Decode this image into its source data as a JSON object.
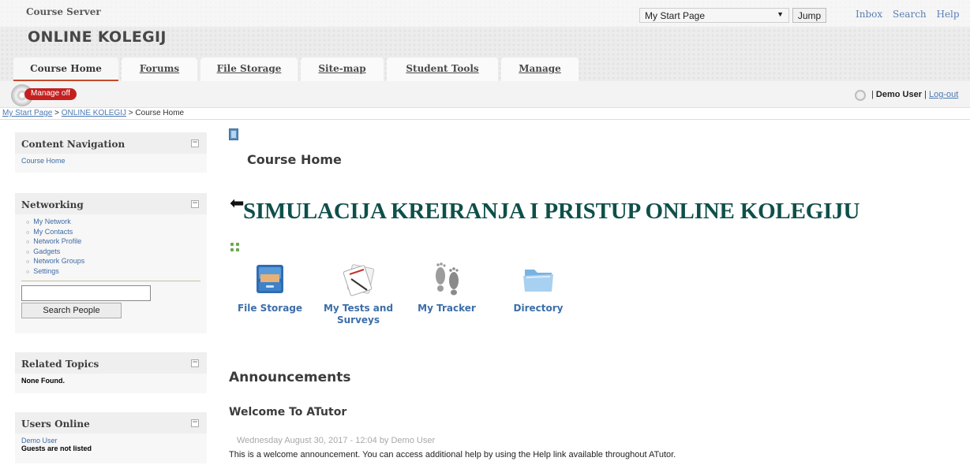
{
  "header": {
    "server_title": "Course Server",
    "course_title": "ONLINE KOLEGIJ",
    "jump_select_value": "My Start Page",
    "jump_button": "Jump",
    "links": [
      "Inbox",
      "Search",
      "Help"
    ]
  },
  "tabs": [
    {
      "label": "Course Home",
      "active": true
    },
    {
      "label": "Forums",
      "active": false
    },
    {
      "label": "File Storage",
      "active": false
    },
    {
      "label": "Site-map",
      "active": false
    },
    {
      "label": "Student Tools",
      "active": false
    },
    {
      "label": "Manage",
      "active": false
    }
  ],
  "manage": {
    "toggle_label": "Manage off",
    "user_name": "Demo User",
    "separator": "|",
    "logout": "Log-out"
  },
  "breadcrumb": {
    "items": [
      "My Start Page",
      "ONLINE KOLEGIJ",
      "Course Home"
    ],
    "separator": ">"
  },
  "sidebar": {
    "content_navigation": {
      "title": "Content Navigation",
      "items": [
        "Course Home"
      ]
    },
    "networking": {
      "title": "Networking",
      "items": [
        "My Network",
        "My Contacts",
        "Network Profile",
        "Gadgets",
        "Network Groups",
        "Settings"
      ],
      "search_button": "Search People"
    },
    "related_topics": {
      "title": "Related Topics",
      "text": "None Found."
    },
    "users_online": {
      "title": "Users Online",
      "user": "Demo User",
      "note": "Guests are not listed"
    },
    "collapse_symbol": "−"
  },
  "main": {
    "page_title": "Course Home",
    "course_heading": "SIMULACIJA KREIRANJA I PRISTUP ONLINE KOLEGIJU",
    "tools": [
      {
        "label": "File Storage",
        "icon": "file-cabinet-icon"
      },
      {
        "label": "My Tests and Surveys",
        "icon": "test-paper-icon"
      },
      {
        "label": "My Tracker",
        "icon": "footprints-icon"
      },
      {
        "label": "Directory",
        "icon": "folder-icon"
      }
    ],
    "announcements_title": "Announcements",
    "announcement": {
      "title": "Welcome To ATutor",
      "date": "Wednesday August 30, 2017 - 12:04 by Demo User",
      "body": "This is a welcome announcement. You can access additional help by using the Help link available throughout ATutor."
    }
  },
  "colors": {
    "accent_tab": "#c44a2a",
    "manage_off": "#c42020",
    "link_blue": "#3c6ea8",
    "course_heading": "#0f4f4a"
  }
}
